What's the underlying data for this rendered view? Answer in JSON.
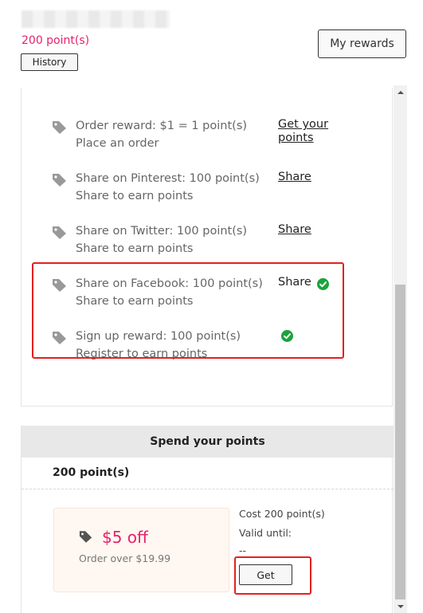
{
  "header": {
    "points_total": "200 point(s)",
    "history_label": "History",
    "my_rewards_label": "My rewards"
  },
  "earn": {
    "items": [
      {
        "title": "Order reward: $1 = 1 point(s)",
        "subtitle": "Place an order",
        "action_line1": "Get your",
        "action_line2": "points",
        "icon": "tag-icon"
      },
      {
        "title": "Share on Pinterest: 100 point(s)",
        "subtitle": "Share to earn points",
        "action": "Share",
        "icon": "tag-icon"
      },
      {
        "title": "Share on Twitter: 100 point(s)",
        "subtitle": "Share to earn points",
        "action": "Share",
        "icon": "tag-icon"
      },
      {
        "title": "Share on Facebook: 100 point(s)",
        "subtitle": "Share to earn points",
        "action": "Share",
        "status_icon": "check-circle-icon",
        "icon": "tag-icon"
      },
      {
        "title": "Sign up reward: 100 point(s)",
        "subtitle": "Register to earn points",
        "status_icon": "check-circle-icon",
        "icon": "tag-icon"
      }
    ]
  },
  "spend": {
    "header": "Spend your points",
    "points": "200 point(s)",
    "coupon": {
      "value": "$5 off",
      "condition": "Order over $19.99",
      "cost": "Cost 200 point(s)",
      "valid_label": "Valid until:",
      "valid_value": "--",
      "get_label": "Get",
      "icon": "tag-icon"
    }
  },
  "colors": {
    "accent": "#e4226b",
    "success": "#1aa33b",
    "highlight": "#e52020"
  }
}
